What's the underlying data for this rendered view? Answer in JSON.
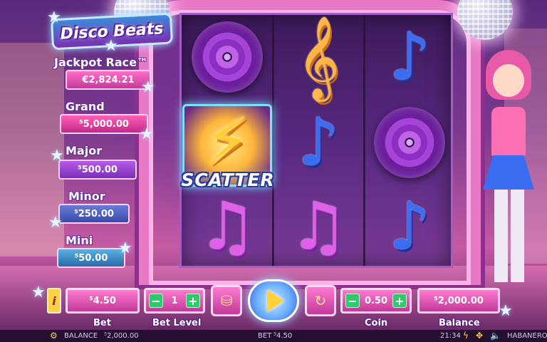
{
  "game": {
    "logo": "Disco Beats"
  },
  "jackpots": {
    "race": {
      "title": "Jackpot Race™",
      "value": "€2,824.21"
    },
    "grand": {
      "title": "Grand",
      "value": "⁵5,000.00"
    },
    "major": {
      "title": "Major",
      "value": "⁵500.00"
    },
    "minor": {
      "title": "Minor",
      "value": "⁵250.00"
    },
    "mini": {
      "title": "Mini",
      "value": "⁵50.00"
    }
  },
  "reels": {
    "scatter_label": "SCATTER",
    "symbols": [
      [
        "vinyl-record",
        "scatter-bolt",
        "pink-note"
      ],
      [
        "gold-treble-clef",
        "blue-note",
        "pink-note"
      ],
      [
        "blue-note",
        "vinyl-record",
        "blue-note"
      ]
    ]
  },
  "controls": {
    "info_label": "i",
    "bet_value": "⁵4.50",
    "bet_label": "Bet",
    "bet_level_value": "1",
    "bet_level_label": "Bet Level",
    "coin_value": "0.50",
    "coin_label": "Coin",
    "balance_value": "⁵2,000.00",
    "balance_label": "Balance",
    "minus": "−",
    "plus": "+"
  },
  "statusbar": {
    "balance_label": "BALANCE",
    "balance_value": "⁵2,000.00",
    "bet_label": "BET",
    "bet_value": "⁵4.50",
    "time": "21:34",
    "brand": "HABANERO"
  },
  "colors": {
    "accent_pink": "#ff7ad0",
    "accent_blue": "#3b6df2",
    "stepper_green": "#2fc86a",
    "spin_yellow": "#ffd23a"
  }
}
